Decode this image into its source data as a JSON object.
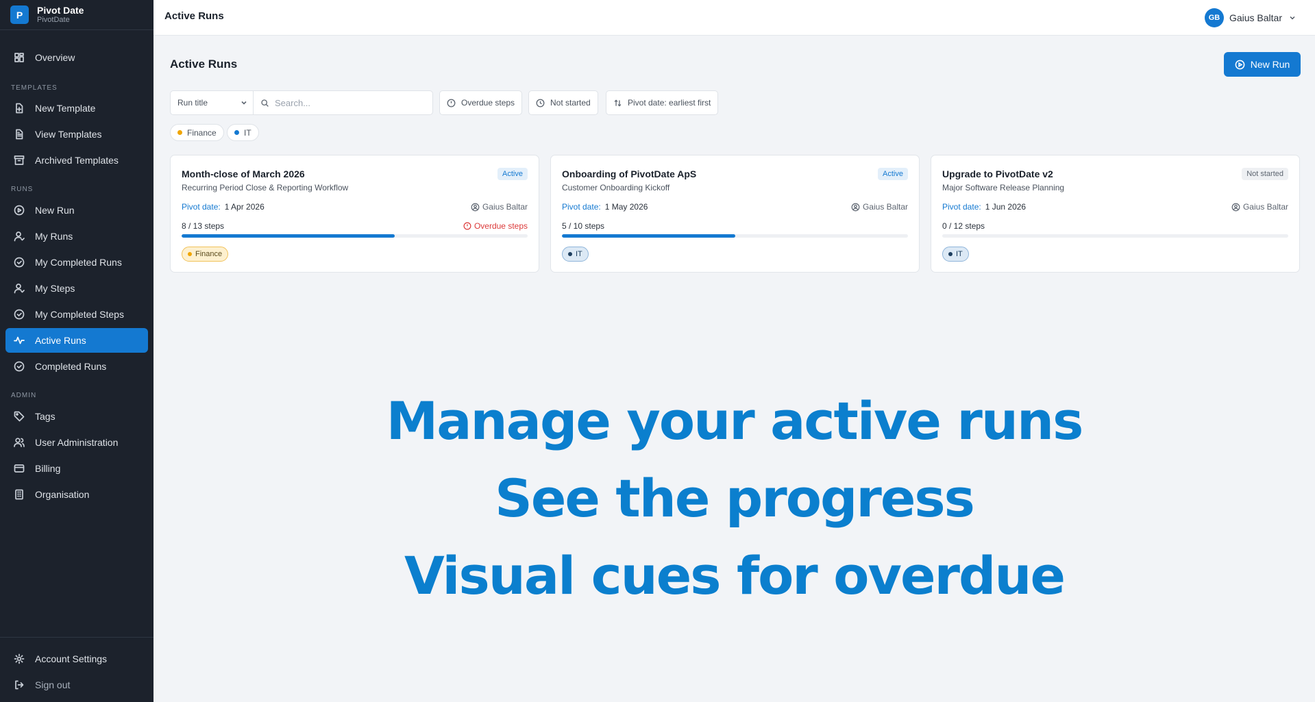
{
  "brand": {
    "initial": "P",
    "name": "Pivot Date",
    "sub": "PivotDate"
  },
  "sidebar": {
    "overview": "Overview",
    "sections": {
      "templates": "TEMPLATES",
      "runs": "RUNS",
      "admin": "ADMIN"
    },
    "templates": [
      "New Template",
      "View Templates",
      "Archived Templates"
    ],
    "runs": [
      "New Run",
      "My Runs",
      "My Completed Runs",
      "My Steps",
      "My Completed Steps",
      "Active Runs",
      "Completed Runs"
    ],
    "admin": [
      "Tags",
      "User Administration",
      "Billing",
      "Organisation"
    ],
    "account_settings": "Account Settings",
    "sign_out": "Sign out",
    "active_item": "Active Runs"
  },
  "header": {
    "title": "Active Runs",
    "user_initials": "GB",
    "user_name": "Gaius Baltar"
  },
  "main": {
    "title": "Active Runs",
    "new_run_label": "New Run",
    "filters": {
      "select_value": "Run title",
      "search_placeholder": "Search...",
      "overdue": "Overdue steps",
      "not_started": "Not started",
      "sort": "Pivot date: earliest first"
    },
    "tags": [
      {
        "label": "Finance",
        "color": "#f0a500"
      },
      {
        "label": "IT",
        "color": "#1479d1"
      }
    ],
    "cards": [
      {
        "title": "Month-close of March 2026",
        "subtitle": "Recurring Period Close & Reporting Workflow",
        "status": "Active",
        "pivot_label": "Pivot date:",
        "pivot_date": "1 Apr 2026",
        "owner": "Gaius Baltar",
        "steps": "8 / 13 steps",
        "progress": 0.615,
        "overdue": "Overdue steps",
        "tag": "Finance"
      },
      {
        "title": "Onboarding of PivotDate ApS",
        "subtitle": "Customer Onboarding Kickoff",
        "status": "Active",
        "pivot_label": "Pivot date:",
        "pivot_date": "1 May 2026",
        "owner": "Gaius Baltar",
        "steps": "5 / 10 steps",
        "progress": 0.5,
        "overdue": "",
        "tag": "IT"
      },
      {
        "title": "Upgrade to PivotDate v2",
        "subtitle": "Major Software Release Planning",
        "status": "Not started",
        "pivot_label": "Pivot date:",
        "pivot_date": "1 Jun 2026",
        "owner": "Gaius Baltar",
        "steps": "0 / 12 steps",
        "progress": 0,
        "overdue": "",
        "tag": "IT"
      }
    ]
  },
  "hero": {
    "line1": "Manage your active runs",
    "line2": "See the progress",
    "line3": "Visual cues for overdue"
  },
  "colors": {
    "accent": "#1479d1",
    "sidebar_bg": "#1c222c",
    "overdue": "#dc3a3a",
    "hero": "#0b7fce"
  }
}
